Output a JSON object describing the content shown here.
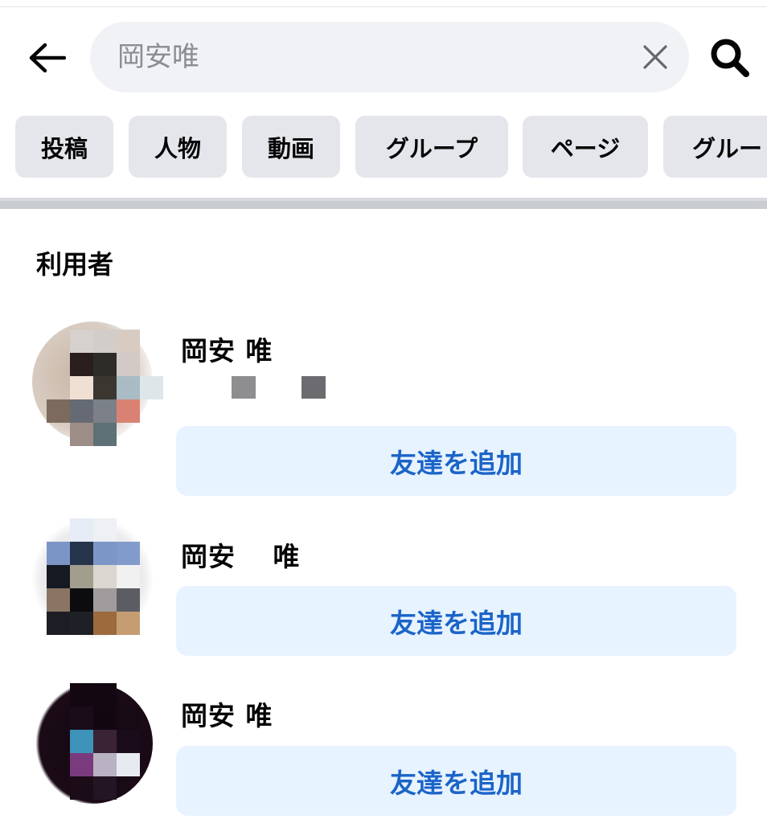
{
  "search": {
    "value": "",
    "placeholder": "岡安唯"
  },
  "icons": {
    "back": "arrow-left-icon",
    "clear": "close-icon",
    "search": "search-icon"
  },
  "filters": [
    "投稿",
    "人物",
    "動画",
    "グループ",
    "ページ",
    "グルー"
  ],
  "section": {
    "title": "利用者"
  },
  "users": [
    {
      "name": "岡安 唯",
      "action": "友達を追加"
    },
    {
      "name": "岡安　 唯",
      "action": "友達を追加"
    },
    {
      "name": "岡安 唯",
      "action": "友達を追加"
    }
  ],
  "colors": {
    "accent": "#1b64c8",
    "button_bg": "#e7f3ff",
    "chip_bg": "#e4e6eb",
    "search_bg": "#f0f2f5"
  }
}
